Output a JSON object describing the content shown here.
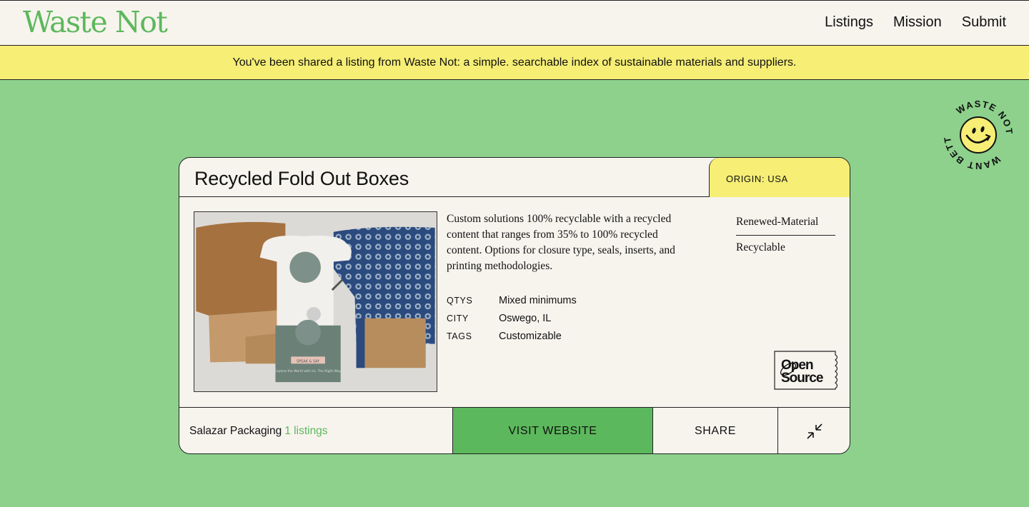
{
  "header": {
    "logo": "Waste Not",
    "nav": [
      "Listings",
      "Mission",
      "Submit"
    ]
  },
  "banner": {
    "text": "You've been shared a listing from Waste Not: a simple. searchable index of sustainable materials and suppliers."
  },
  "badge": {
    "top_text": "WASTE NOT",
    "bottom_text": "WANT BETTER",
    "icon": "smiley-icon"
  },
  "listing": {
    "title": "Recycled Fold Out Boxes",
    "origin": "ORIGIN: USA",
    "description": "Custom solutions 100% recyclable with a recycled content that ranges from 35% to 100% recycled content. Options for closure type, seals, inserts, and printing methodologies.",
    "meta": [
      {
        "key": "QTYS",
        "value": "Mixed minimums"
      },
      {
        "key": "CITY",
        "value": "Oswego, IL"
      },
      {
        "key": "TAGS",
        "value": "Customizable"
      }
    ],
    "categories": [
      "Renewed-Material",
      "Recyclable"
    ],
    "open_source_logo": {
      "line1": "Open",
      "line2": "Source"
    },
    "photo_text": {
      "label": "SPEAK & SAY",
      "caption": "Explore the World with Us. The Right Way."
    }
  },
  "footer": {
    "supplier": "Salazar Packaging",
    "listings_count": "1 listings",
    "visit": "VISIT WEBSITE",
    "share": "SHARE"
  },
  "colors": {
    "background": "#8dd18c",
    "accent_green": "#5cb85c",
    "banner_yellow": "#f6ee75",
    "paper": "#f7f4ee"
  }
}
